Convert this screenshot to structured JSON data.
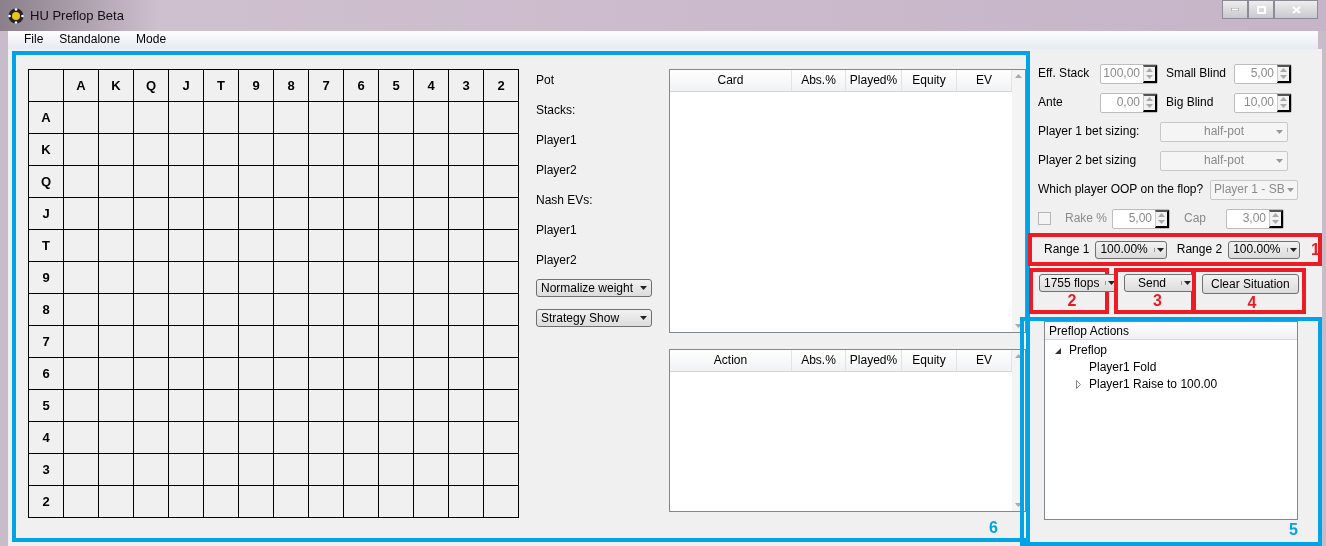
{
  "window": {
    "title": "HU Preflop Beta"
  },
  "menu": [
    "File",
    "Standalone",
    "Mode"
  ],
  "hand_grid": {
    "columns": [
      "A",
      "K",
      "Q",
      "J",
      "T",
      "9",
      "8",
      "7",
      "6",
      "5",
      "4",
      "3",
      "2"
    ],
    "rows": [
      "A",
      "K",
      "Q",
      "J",
      "T",
      "9",
      "8",
      "7",
      "6",
      "5",
      "4",
      "3",
      "2"
    ]
  },
  "info_labels": [
    "Pot",
    "Stacks:",
    "Player1",
    "Player2",
    "Nash EVs:",
    "Player1",
    "Player2"
  ],
  "view_dropdowns": [
    "Normalize weight",
    "Strategy Show"
  ],
  "tables": [
    {
      "columns": [
        "Card",
        "Abs.%",
        "Played%",
        "Equity",
        "EV"
      ]
    },
    {
      "columns": [
        "Action",
        "Abs.%",
        "Played%",
        "Equity",
        "EV"
      ]
    }
  ],
  "settings": {
    "spin_rows": [
      [
        {
          "label": "Eff. Stack",
          "value": "100,00",
          "disabled": true
        },
        {
          "label": "Small Blind",
          "value": "5,00",
          "disabled": true
        }
      ],
      [
        {
          "label": "Ante",
          "value": "0,00",
          "disabled": true
        },
        {
          "label": "Big Blind",
          "value": "10,00",
          "disabled": true
        }
      ]
    ],
    "combos": [
      {
        "label": "Player 1 bet sizing:",
        "value": "half-pot",
        "disabled": true
      },
      {
        "label": "Player 2 bet sizing",
        "value": "half-pot",
        "disabled": true
      },
      {
        "label": "Which player OOP on the flop?",
        "value": "Player 1 - SB",
        "disabled": true
      }
    ],
    "rake": {
      "checked": false,
      "disabled": true,
      "label": "Rake %",
      "value": "5,00",
      "cap_label": "Cap",
      "cap_value": "3,00"
    }
  },
  "ranges": [
    {
      "label": "Range 1",
      "value": "100.00%"
    },
    {
      "label": "Range 2",
      "value": "100.00%"
    }
  ],
  "actions": [
    {
      "kind": "split",
      "label": "1755 flops"
    },
    {
      "kind": "split",
      "label": "Send"
    },
    {
      "kind": "button",
      "label": "Clear Situation"
    }
  ],
  "tree": {
    "header": "Preflop Actions",
    "nodes": [
      {
        "label": "Preflop",
        "expandable": true,
        "expanded": true,
        "children": [
          {
            "label": "Player1 Fold",
            "expandable": false,
            "expanded": false
          },
          {
            "label": "Player1 Raise to 100.00",
            "expandable": true,
            "expanded": false
          }
        ]
      }
    ]
  },
  "annotations": [
    {
      "label": "1",
      "color": "#ed1c24"
    },
    {
      "label": "2",
      "color": "#ed1c24"
    },
    {
      "label": "3",
      "color": "#ed1c24"
    },
    {
      "label": "4",
      "color": "#ed1c24"
    },
    {
      "label": "5",
      "color": "#00a2e8"
    },
    {
      "label": "6",
      "color": "#00a2e8"
    }
  ]
}
